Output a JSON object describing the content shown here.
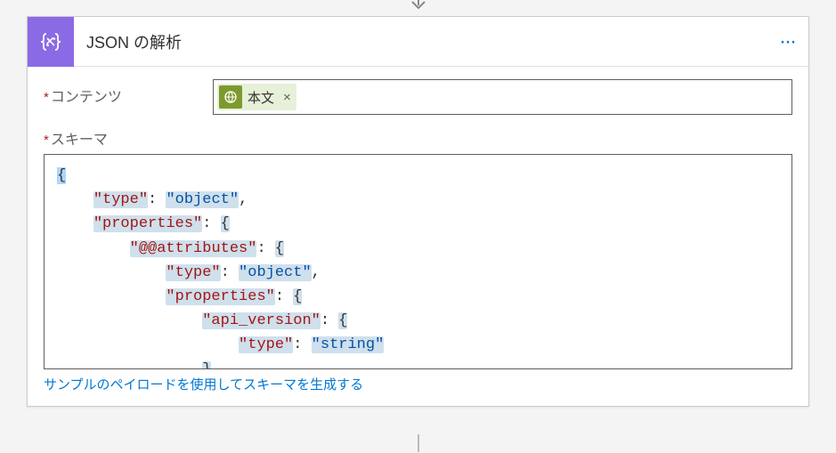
{
  "header": {
    "title": "JSON の解析"
  },
  "fields": {
    "content_label": "コンテンツ",
    "schema_label": "スキーマ",
    "token": {
      "label": "本文"
    }
  },
  "link": {
    "generate_schema": "サンプルのペイロードを使用してスキーマを生成する"
  },
  "schema_tokens": [
    {
      "indent": 0,
      "parts": [
        {
          "t": "{",
          "c": "punc",
          "hl": "cur"
        }
      ]
    },
    {
      "indent": 1,
      "parts": [
        {
          "t": "\"type\"",
          "c": "key",
          "hl": "y"
        },
        {
          "t": ": ",
          "c": "punc"
        },
        {
          "t": "\"object\"",
          "c": "str",
          "hl": "y"
        },
        {
          "t": ",",
          "c": "punc"
        }
      ]
    },
    {
      "indent": 1,
      "parts": [
        {
          "t": "\"properties\"",
          "c": "key",
          "hl": "y"
        },
        {
          "t": ": ",
          "c": "punc"
        },
        {
          "t": "{",
          "c": "punc",
          "hl": "y"
        }
      ]
    },
    {
      "indent": 2,
      "parts": [
        {
          "t": "\"@@attributes\"",
          "c": "key",
          "hl": "y"
        },
        {
          "t": ": ",
          "c": "punc"
        },
        {
          "t": "{",
          "c": "punc",
          "hl": "y"
        }
      ]
    },
    {
      "indent": 3,
      "parts": [
        {
          "t": "\"type\"",
          "c": "key",
          "hl": "y"
        },
        {
          "t": ": ",
          "c": "punc"
        },
        {
          "t": "\"object\"",
          "c": "str",
          "hl": "y"
        },
        {
          "t": ",",
          "c": "punc"
        }
      ]
    },
    {
      "indent": 3,
      "parts": [
        {
          "t": "\"properties\"",
          "c": "key",
          "hl": "y"
        },
        {
          "t": ": ",
          "c": "punc"
        },
        {
          "t": "{",
          "c": "punc",
          "hl": "y"
        }
      ]
    },
    {
      "indent": 4,
      "parts": [
        {
          "t": "\"api_version\"",
          "c": "key",
          "hl": "y"
        },
        {
          "t": ": ",
          "c": "punc"
        },
        {
          "t": "{",
          "c": "punc",
          "hl": "y"
        }
      ]
    },
    {
      "indent": 5,
      "parts": [
        {
          "t": "\"type\"",
          "c": "key",
          "hl": "y"
        },
        {
          "t": ": ",
          "c": "punc"
        },
        {
          "t": "\"string\"",
          "c": "str",
          "hl": "y"
        }
      ]
    },
    {
      "indent": 4,
      "parts": [
        {
          "t": "}",
          "c": "punc",
          "hl": "y"
        }
      ]
    }
  ]
}
